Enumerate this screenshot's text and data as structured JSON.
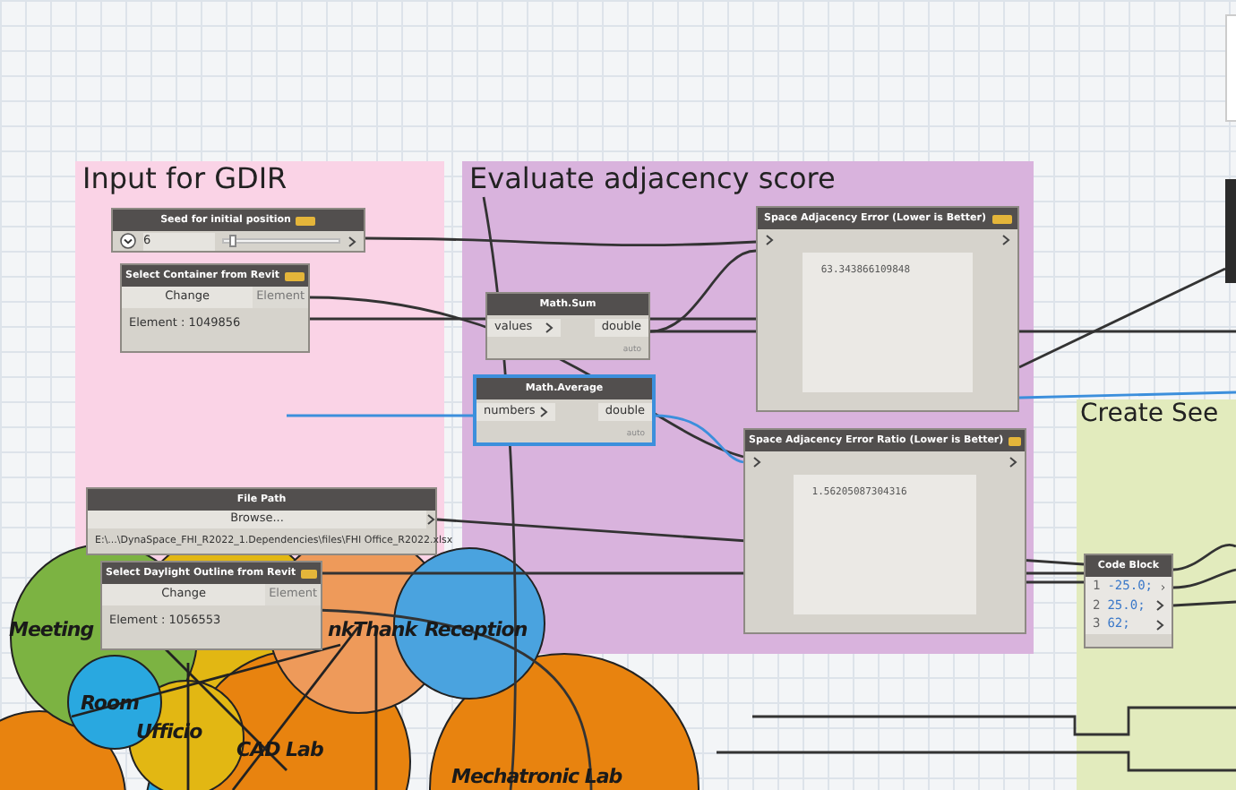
{
  "groups": [
    {
      "title": "Input for GDIR",
      "color": "#fad3e6"
    },
    {
      "title": "Evaluate adjacency score",
      "color": "#d9b3dd"
    },
    {
      "title": "Create See",
      "color": "#e2ebbd"
    }
  ],
  "rooms": [
    {
      "label": "Meeting",
      "color": "#7cb342"
    },
    {
      "label": "nkThank",
      "color": "#ee9a5a"
    },
    {
      "label": "Reception",
      "color": "#4aa3df"
    },
    {
      "label": "Room",
      "color": "#29a8e0"
    },
    {
      "label": "Ufficio",
      "color": "#e2b713"
    },
    {
      "label": "CAD Lab",
      "color": "#e8830f"
    },
    {
      "label": "Mechatronic Lab",
      "color": "#e8830f"
    }
  ],
  "nodes": [
    {
      "kind": "slider",
      "title": "Seed for initial position",
      "tagged": true,
      "selected": false,
      "value": "6",
      "level": 0.05
    },
    {
      "kind": "selection",
      "title": "Select Container from Revit",
      "tagged": true,
      "selected": false,
      "button": "Change",
      "output": "Element",
      "result": "Element : 1049856"
    },
    {
      "kind": "function",
      "title": "Math.Sum",
      "tagged": false,
      "selected": false,
      "input": "values",
      "output": "double",
      "lacing": "auto"
    },
    {
      "kind": "function",
      "title": "Math.Average",
      "tagged": false,
      "selected": true,
      "input": "numbers",
      "output": "double",
      "lacing": "auto"
    },
    {
      "kind": "watch",
      "title": "Space Adjacency Error (Lower is Better)",
      "tagged": true,
      "selected": false,
      "value": "63.343866109848"
    },
    {
      "kind": "watch",
      "title": "Space Adjacency Error Ratio (Lower is Better)",
      "tagged": true,
      "selected": false,
      "value": "1.56205087304316"
    },
    {
      "kind": "filepath",
      "title": "File Path",
      "tagged": false,
      "selected": false,
      "button": "Browse...",
      "value": "E:\\...\\DynaSpace_FHI_R2022_1.Dependencies\\files\\FHI Office_R2022.xlsx"
    },
    {
      "kind": "selection",
      "title": "Select Daylight Outline from Revit",
      "tagged": true,
      "selected": false,
      "button": "Change",
      "output": "Element",
      "result": "Element : 1056553"
    },
    {
      "kind": "codeblock",
      "title": "Code Block",
      "tagged": false,
      "selected": false,
      "lines": [
        {
          "number": "1",
          "code": "-25.0;"
        },
        {
          "number": "2",
          "code": "25.0;"
        },
        {
          "number": "3",
          "code": "62;"
        }
      ]
    }
  ]
}
